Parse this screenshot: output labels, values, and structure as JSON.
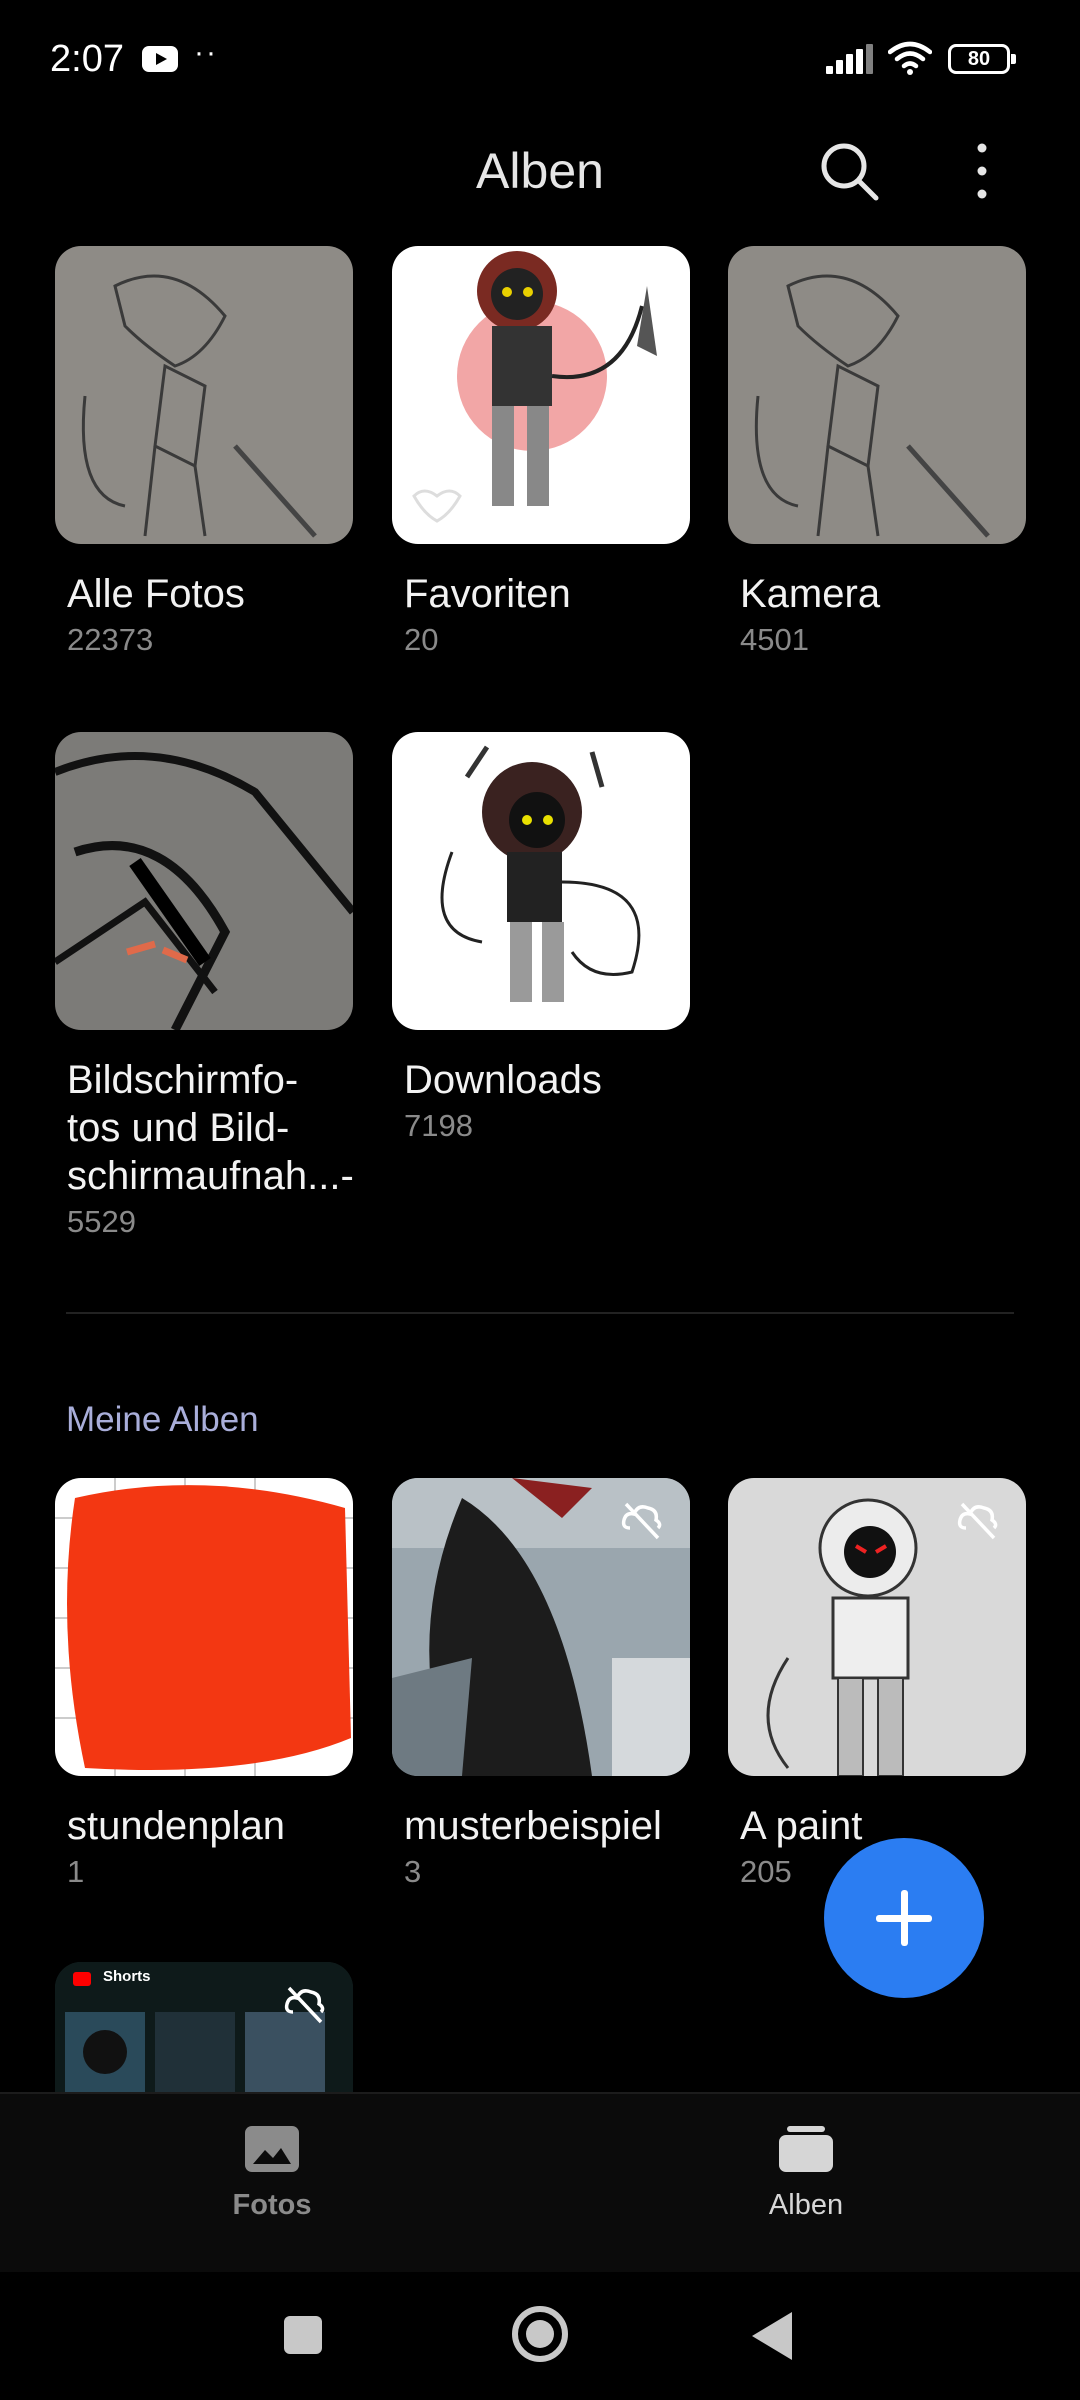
{
  "status_bar": {
    "time": "2:07",
    "battery": "80",
    "icons": [
      "youtube-icon",
      "more-notifications-icon",
      "signal-icon",
      "wifi-icon",
      "battery-icon"
    ]
  },
  "header": {
    "title": "Alben",
    "actions": [
      "search-icon",
      "more-vert-icon"
    ]
  },
  "albums": [
    {
      "name": "Alle Fotos",
      "count": "22373"
    },
    {
      "name": "Favoriten",
      "count": "20"
    },
    {
      "name": "Kamera",
      "count": "4501"
    },
    {
      "name": "Bildschirmfo-\ntos und Bild-\nschirmaufnah...-",
      "count": "5529"
    },
    {
      "name": "Downloads",
      "count": "7198"
    }
  ],
  "my_albums": {
    "section_label": "Meine Alben",
    "items": [
      {
        "name": "stundenplan",
        "count": "1"
      },
      {
        "name": "musterbeispiel",
        "count": "3"
      },
      {
        "name": "A paint",
        "count": "205"
      },
      {
        "thumb_label": "Shorts"
      }
    ]
  },
  "bottom_nav": {
    "items": [
      {
        "label": "Fotos",
        "icon": "photo-icon",
        "active": false
      },
      {
        "label": "Alben",
        "icon": "albums-icon",
        "active": true
      }
    ]
  },
  "colors": {
    "background": "#000000",
    "accent": "#2b7df2",
    "section_label": "#a9aeda",
    "count_text": "#8a8a8a"
  }
}
